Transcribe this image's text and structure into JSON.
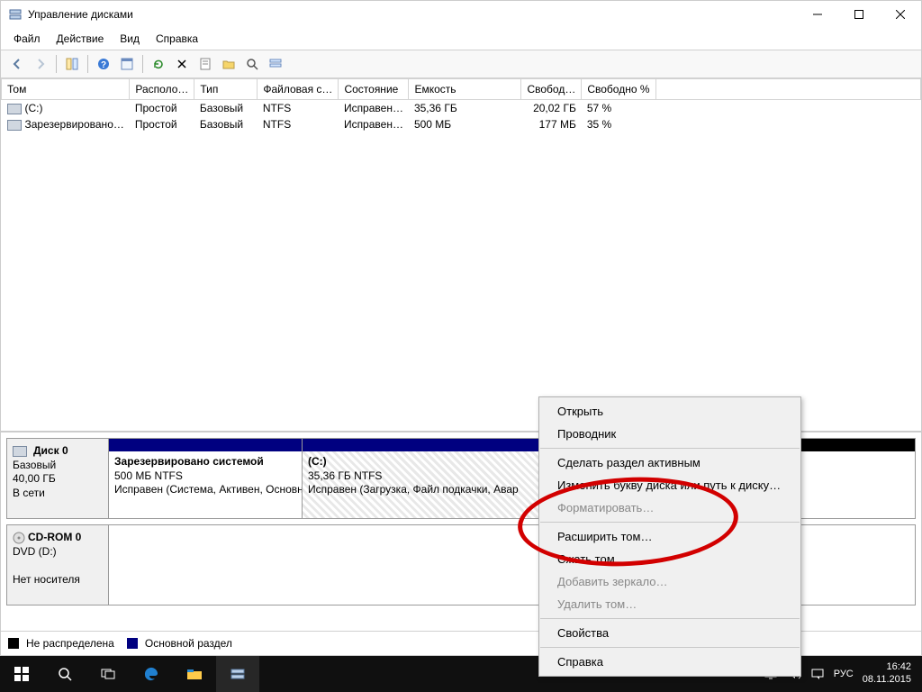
{
  "window": {
    "title": "Управление дисками"
  },
  "menu": {
    "file": "Файл",
    "action": "Действие",
    "view": "Вид",
    "help": "Справка"
  },
  "columns": {
    "volume": "Том",
    "layout": "Располо…",
    "type": "Тип",
    "filesystem": "Файловая с…",
    "status": "Состояние",
    "capacity": "Емкость",
    "free": "Свобод…",
    "free_pct": "Свободно %"
  },
  "rows": [
    {
      "volume": "(C:)",
      "layout": "Простой",
      "type": "Базовый",
      "fs": "NTFS",
      "status": "Исправен…",
      "capacity": "35,36 ГБ",
      "free": "20,02 ГБ",
      "pct": "57 %"
    },
    {
      "volume": "Зарезервировано…",
      "layout": "Простой",
      "type": "Базовый",
      "fs": "NTFS",
      "status": "Исправен…",
      "capacity": "500 МБ",
      "free": "177 МБ",
      "pct": "35 %"
    }
  ],
  "disk0": {
    "title": "Диск 0",
    "type": "Базовый",
    "size": "40,00 ГБ",
    "state": "В сети",
    "reserved": {
      "name": "Зарезервировано системой",
      "info": "500 МБ NTFS",
      "status": "Исправен (Система, Активен, Основн"
    },
    "c": {
      "name": "(C:)",
      "info": "35,36 ГБ NTFS",
      "status": "Исправен (Загрузка, Файл подкачки, Авар"
    }
  },
  "cdrom": {
    "title": "CD-ROM 0",
    "sub": "DVD (D:)",
    "empty": "Нет носителя"
  },
  "legend": {
    "unalloc": "Не распределена",
    "primary": "Основной раздел"
  },
  "context": {
    "open": "Открыть",
    "explorer": "Проводник",
    "active": "Сделать раздел активным",
    "letter": "Изменить букву диска или путь к диску…",
    "format": "Форматировать…",
    "extend": "Расширить том…",
    "shrink": "Сжать том…",
    "mirror": "Добавить зеркало…",
    "delete": "Удалить том…",
    "props": "Свойства",
    "help": "Справка"
  },
  "tray": {
    "lang": "РУС",
    "time": "16:42",
    "date": "08.11.2015"
  }
}
